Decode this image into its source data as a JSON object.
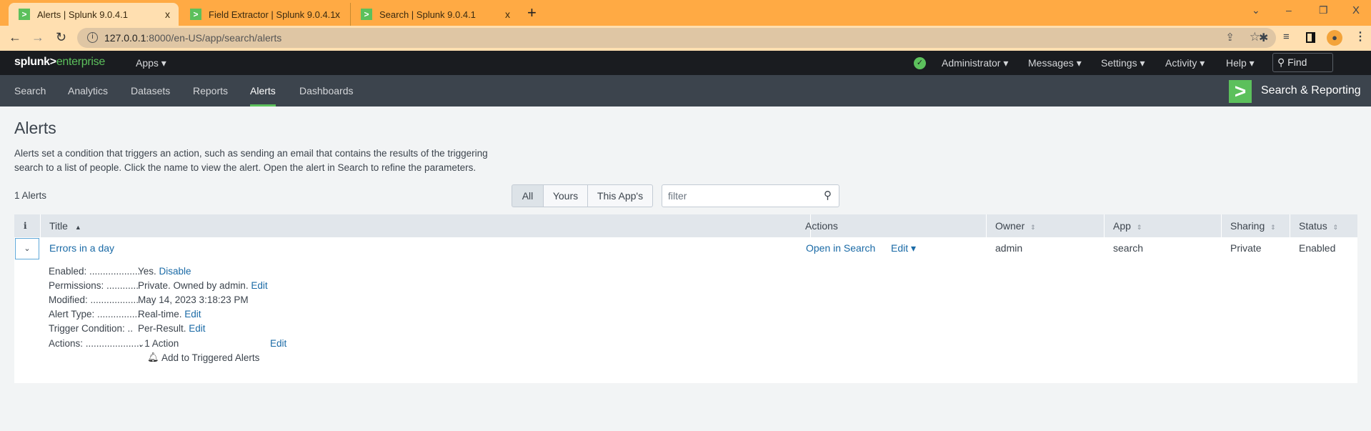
{
  "browser": {
    "tabs": [
      {
        "label": "Alerts | Splunk 9.0.4.1",
        "active": true
      },
      {
        "label": "Field Extractor | Splunk 9.0.4.1",
        "active": false
      },
      {
        "label": "Search | Splunk 9.0.4.1",
        "active": false
      }
    ],
    "new_tab": "+",
    "url_host": "127.0.0.1",
    "url_path": ":8000/en-US/app/search/alerts",
    "tab_close": "x",
    "window_controls": {
      "dropdown": "⌄",
      "minimize": "–",
      "restore": "❐",
      "close": "X"
    }
  },
  "header": {
    "logo_a": "splunk>",
    "logo_b": "enterprise",
    "apps": "Apps",
    "menus": [
      "Administrator",
      "Messages",
      "Settings",
      "Activity",
      "Help"
    ],
    "find_placeholder": "Find",
    "status_color": "#5cc05c"
  },
  "appnav": {
    "items": [
      "Search",
      "Analytics",
      "Datasets",
      "Reports",
      "Alerts",
      "Dashboards"
    ],
    "active": "Alerts",
    "app_name": "Search & Reporting"
  },
  "page": {
    "title": "Alerts",
    "description_1": "Alerts set a condition that triggers an action, such as sending an email that contains the results of the triggering",
    "description_2": "search to a list of people. Click the name to view the alert. Open the alert in Search to refine the parameters.",
    "count": "1 Alerts",
    "filters": [
      "All",
      "Yours",
      "This App's"
    ],
    "filter_placeholder": "filter"
  },
  "table": {
    "info_col": "i",
    "columns": [
      "Title",
      "Actions",
      "Owner",
      "App",
      "Sharing",
      "Status"
    ],
    "row": {
      "title": "Errors in a day",
      "open_in_search": "Open in Search",
      "edit": "Edit",
      "owner": "admin",
      "app": "search",
      "sharing": "Private",
      "status": "Enabled"
    },
    "details": {
      "enabled_label": "Enabled: ...................",
      "enabled_value": "Yes.",
      "enabled_link": "Disable",
      "permissions_label": "Permissions: ............",
      "permissions_value": "Private. Owned by admin.",
      "permissions_link": "Edit",
      "modified_label": "Modified: ..................",
      "modified_value": "May 14, 2023 3:18:23 PM",
      "alert_type_label": "Alert Type: ................",
      "alert_type_value": "Real-time.",
      "alert_type_link": "Edit",
      "trigger_label": "Trigger Condition: ..",
      "trigger_value": "Per-Result.",
      "trigger_link": "Edit",
      "actions_label": "Actions: .....................",
      "actions_value": "1 Action",
      "actions_link": "Edit",
      "action_item": "Add to Triggered Alerts"
    }
  }
}
